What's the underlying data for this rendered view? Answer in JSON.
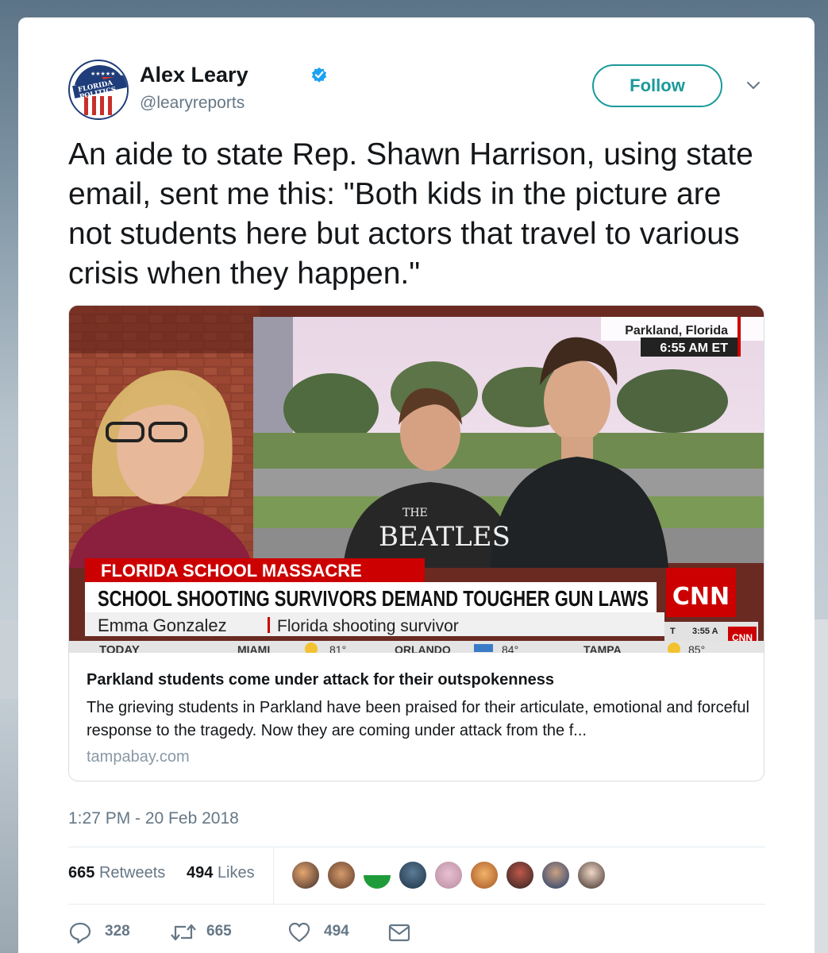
{
  "author": {
    "name": "Alex Leary",
    "handle": "@learyreports",
    "verified": true,
    "avatar_text": [
      "FLORIDA",
      "POLITICS"
    ]
  },
  "follow_label": "Follow",
  "tweet_text": "An aide to state Rep. Shawn Harrison, using state email, sent me this: \"Both kids in the picture are not students here but actors that travel to various crisis when they happen.\"",
  "card": {
    "media": {
      "location": "Parkland, Florida",
      "time": "6:55 AM ET",
      "shirt_text_small": "THE",
      "shirt_text": "BEATLES",
      "banner_top": "FLORIDA SCHOOL MASSACRE",
      "banner_main": "SCHOOL SHOOTING SURVIVORS DEMAND TOUGHER GUN LAWS",
      "network_logo": "CNN",
      "lower_name": "Emma Gonzalez",
      "lower_desc": "Florida shooting survivor",
      "corner_time": "3:55 A",
      "corner_label": "T",
      "ticker": [
        "TODAY",
        "MIAMI",
        "81°",
        "ORLANDO",
        "84°",
        "TAMPA",
        "85°"
      ]
    },
    "title": "Parkland students come under attack for their outspokenness",
    "description": "The grieving students in Parkland have been praised for their articulate, emotional and forceful response to the tragedy. Now they are coming under attack from the f...",
    "domain": "tampabay.com"
  },
  "timestamp": "1:27 PM - 20 Feb 2018",
  "stats": {
    "retweets_count": "665",
    "retweets_label": "Retweets",
    "likes_count": "494",
    "likes_label": "Likes"
  },
  "likers_count_shown": 9,
  "actions": {
    "replies": "328",
    "retweets": "665",
    "likes": "494"
  },
  "colors": {
    "accent": "#1a9a9a",
    "verified": "#1da1f2",
    "cnn_red": "#cc0000",
    "muted": "#657786"
  }
}
